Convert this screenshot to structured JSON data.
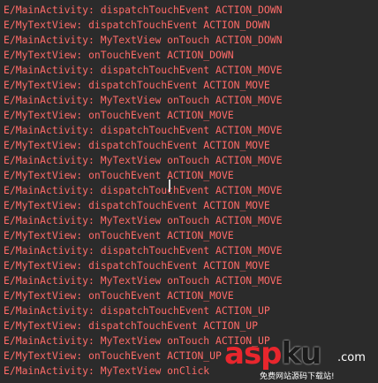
{
  "log": {
    "lines": [
      "E/MainActivity: dispatchTouchEvent ACTION_DOWN",
      "E/MyTextView: dispatchTouchEvent ACTION_DOWN",
      "E/MainActivity: MyTextView onTouch ACTION_DOWN",
      "E/MyTextView: onTouchEvent ACTION_DOWN",
      "E/MainActivity: dispatchTouchEvent ACTION_MOVE",
      "E/MyTextView: dispatchTouchEvent ACTION_MOVE",
      "E/MainActivity: MyTextView onTouch ACTION_MOVE",
      "E/MyTextView: onTouchEvent ACTION_MOVE",
      "E/MainActivity: dispatchTouchEvent ACTION_MOVE",
      "E/MyTextView: dispatchTouchEvent ACTION_MOVE",
      "E/MainActivity: MyTextView onTouch ACTION_MOVE",
      "E/MyTextView: onTouchEvent ACTION_MOVE",
      "E/MainActivity: dispatchTouchEvent ACTION_MOVE",
      "E/MyTextView: dispatchTouchEvent ACTION_MOVE",
      "E/MainActivity: MyTextView onTouch ACTION_MOVE",
      "E/MyTextView: onTouchEvent ACTION_MOVE",
      "E/MainActivity: dispatchTouchEvent ACTION_MOVE",
      "E/MyTextView: dispatchTouchEvent ACTION_MOVE",
      "E/MainActivity: MyTextView onTouch ACTION_MOVE",
      "E/MyTextView: onTouchEvent ACTION_MOVE",
      "E/MainActivity: dispatchTouchEvent ACTION_UP",
      "E/MyTextView: dispatchTouchEvent ACTION_UP",
      "E/MainActivity: MyTextView onTouch ACTION_UP",
      "E/MyTextView: onTouchEvent ACTION_UP",
      "E/MainActivity: MyTextView onClick"
    ]
  },
  "watermark": {
    "brand_red": "asp",
    "brand_dark": "ku",
    "domain_suffix": ".com",
    "tagline": "免费网站源码下载站!"
  },
  "colors": {
    "background": "#2b2b2b",
    "log_error_text": "#ff6b68",
    "watermark_red": "#e8262d"
  }
}
